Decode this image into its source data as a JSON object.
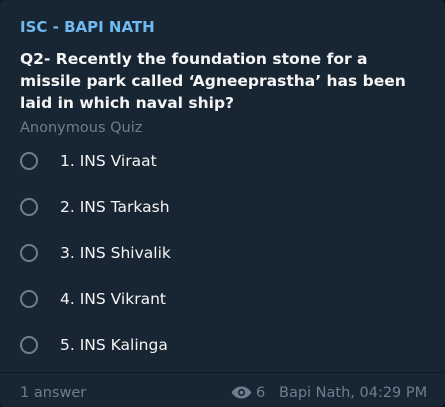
{
  "message": {
    "sender": "ISC - BAPI NATH",
    "question": "Q2- Recently the foundation stone for a missile park called ‘Agneeprastha’ has been laid in which naval ship?",
    "quiz_type": "Anonymous Quiz",
    "options": [
      {
        "label": "1. INS Viraat"
      },
      {
        "label": "2. INS Tarkash"
      },
      {
        "label": "3. INS Shivalik"
      },
      {
        "label": "4. INS Vikrant"
      },
      {
        "label": "5. INS Kalinga"
      }
    ],
    "footer": {
      "answers": "1 answer",
      "views_icon": "eye-icon",
      "views": "6",
      "author_time": "Bapi Nath, 04:29 PM"
    }
  },
  "colors": {
    "background": "#0e1621",
    "bubble": "#182533",
    "sender": "#71baf0",
    "text": "#f5f5f5",
    "muted": "#6d7f8f"
  }
}
